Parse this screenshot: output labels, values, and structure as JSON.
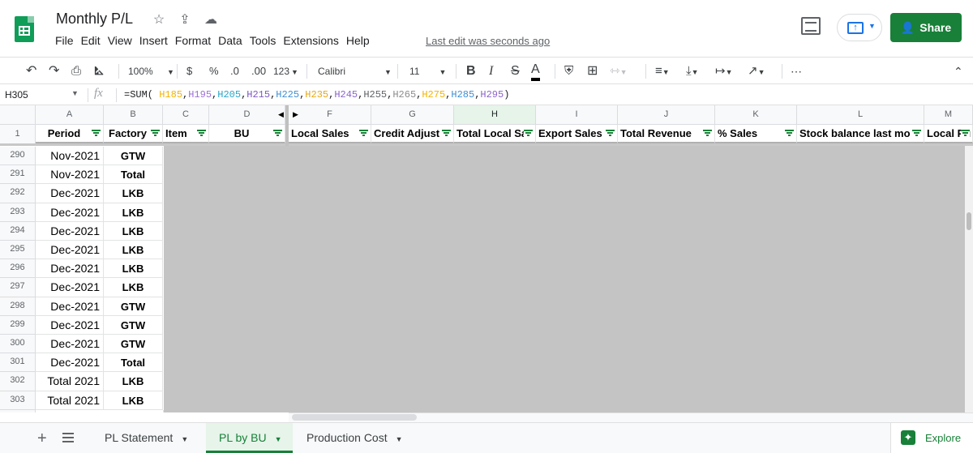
{
  "app": {
    "title": "Monthly P/L",
    "star_icon": "☆",
    "move_icon": "⇪",
    "cloud_icon": "☁",
    "last_edit": "Last edit was seconds ago",
    "share_label": "Share"
  },
  "menu": [
    "File",
    "Edit",
    "View",
    "Insert",
    "Format",
    "Data",
    "Tools",
    "Extensions",
    "Help"
  ],
  "toolbar": {
    "zoom": "100%",
    "currency": "$",
    "percent": "%",
    "dec_less": ".0",
    "dec_more": ".00",
    "format_123": "123",
    "font": "Calibri",
    "font_size": "11",
    "bold": "B",
    "italic": "I",
    "strike": "S",
    "text_color": "A",
    "more": "⋯"
  },
  "formula_bar": {
    "cell_ref": "H305",
    "fx": "fx",
    "formula_prefix": "=SUM(",
    "refs": [
      {
        "text": "H185",
        "color": "#f4b400"
      },
      {
        "text": "H195",
        "color": "#9c6fd6"
      },
      {
        "text": "H205",
        "color": "#26a6c9"
      },
      {
        "text": "H215",
        "color": "#7e57c2"
      },
      {
        "text": "H225",
        "color": "#3f8fd6"
      },
      {
        "text": "H235",
        "color": "#e6a817"
      },
      {
        "text": "H245",
        "color": "#8b64c9"
      },
      {
        "text": "H255",
        "color": "#5f6368"
      },
      {
        "text": "H265",
        "color": "#8c8c8c"
      },
      {
        "text": "H275",
        "color": "#f4b400"
      },
      {
        "text": "H285",
        "color": "#3f8fd6"
      },
      {
        "text": "H295",
        "color": "#8b64c9"
      }
    ],
    "formula_suffix": ")"
  },
  "columns": [
    "A",
    "B",
    "C",
    "D",
    "F",
    "G",
    "H",
    "I",
    "J",
    "K",
    "L",
    "M"
  ],
  "header_row_number": "1",
  "headers": [
    "Period",
    "Factory",
    "Item",
    "BU",
    "Local Sales",
    "Credit Adjust",
    "Total Local Sa",
    "Export Sales",
    "Total Revenue",
    "% Sales",
    "Stock balance last mo",
    "Local Pu"
  ],
  "rows": [
    {
      "n": "290",
      "period": "Nov-2021",
      "factory": "GTW"
    },
    {
      "n": "291",
      "period": "Nov-2021",
      "factory": "Total"
    },
    {
      "n": "292",
      "period": "Dec-2021",
      "factory": "LKB"
    },
    {
      "n": "293",
      "period": "Dec-2021",
      "factory": "LKB"
    },
    {
      "n": "294",
      "period": "Dec-2021",
      "factory": "LKB"
    },
    {
      "n": "295",
      "period": "Dec-2021",
      "factory": "LKB"
    },
    {
      "n": "296",
      "period": "Dec-2021",
      "factory": "LKB"
    },
    {
      "n": "297",
      "period": "Dec-2021",
      "factory": "LKB"
    },
    {
      "n": "298",
      "period": "Dec-2021",
      "factory": "GTW"
    },
    {
      "n": "299",
      "period": "Dec-2021",
      "factory": "GTW"
    },
    {
      "n": "300",
      "period": "Dec-2021",
      "factory": "GTW"
    },
    {
      "n": "301",
      "period": "Dec-2021",
      "factory": "Total"
    },
    {
      "n": "302",
      "period": "Total 2021",
      "factory": "LKB"
    },
    {
      "n": "303",
      "period": "Total 2021",
      "factory": "LKB"
    }
  ],
  "sheet_tabs": [
    {
      "label": "PL Statement",
      "active": false
    },
    {
      "label": "PL by BU",
      "active": true
    },
    {
      "label": "Production Cost",
      "active": false
    }
  ],
  "explore_label": "Explore",
  "colors": {
    "accent": "#188038",
    "selected_header": "#e6f4ea",
    "grey_area": "#c4c4c4"
  }
}
